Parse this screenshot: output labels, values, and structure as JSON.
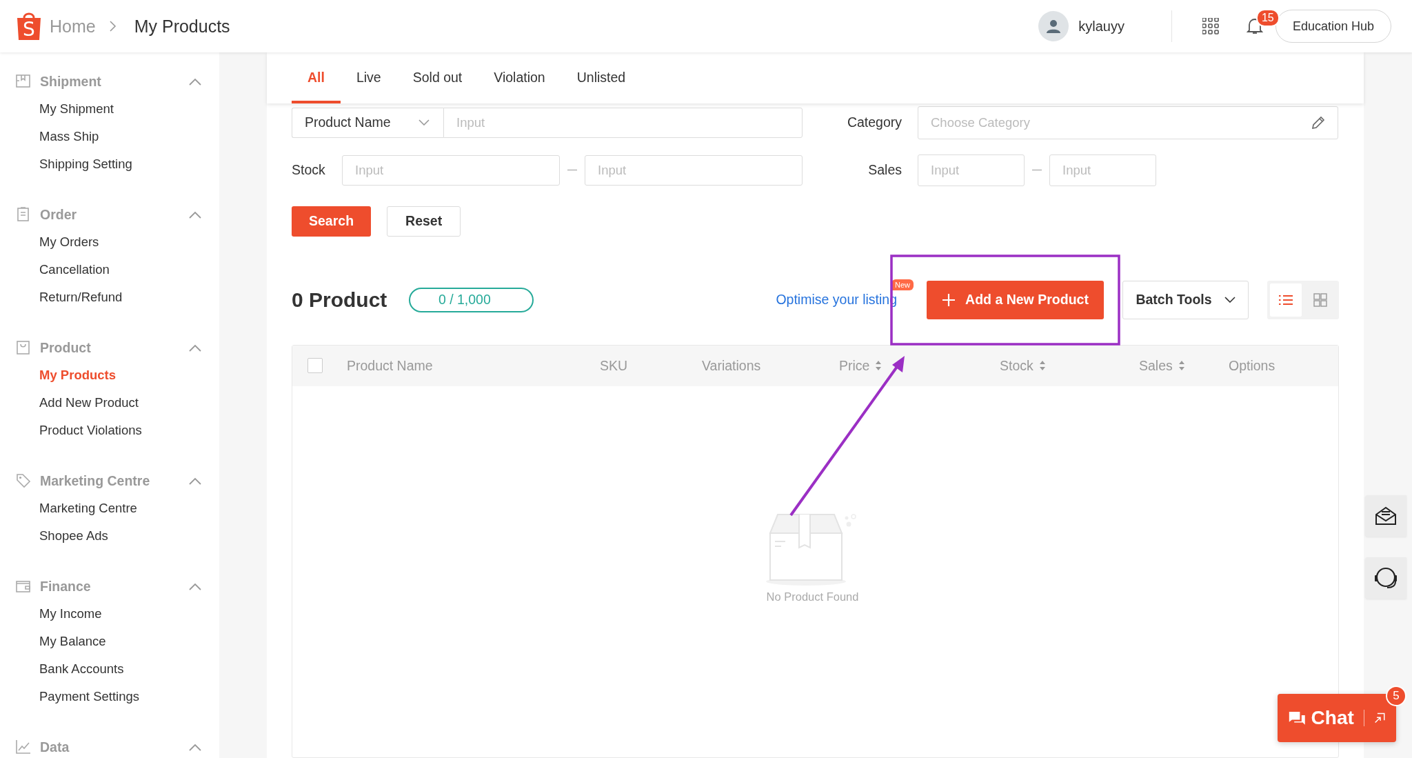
{
  "header": {
    "logo_letter": "S",
    "breadcrumb": [
      {
        "label": "Home"
      },
      {
        "label": "My Products"
      }
    ],
    "user": {
      "name": "kylauyy"
    },
    "notifications": {
      "count": "15"
    },
    "education_hub": "Education Hub"
  },
  "sidebar": {
    "sections": [
      {
        "title": "Shipment",
        "expanded": true,
        "items": [
          {
            "label": "My Shipment",
            "selected": false
          },
          {
            "label": "Mass Ship",
            "selected": false
          },
          {
            "label": "Shipping Setting",
            "selected": false
          }
        ]
      },
      {
        "title": "Order",
        "expanded": true,
        "items": [
          {
            "label": "My Orders",
            "selected": false
          },
          {
            "label": "Cancellation",
            "selected": false
          },
          {
            "label": "Return/Refund",
            "selected": false
          }
        ]
      },
      {
        "title": "Product",
        "expanded": true,
        "items": [
          {
            "label": "My Products",
            "selected": true
          },
          {
            "label": "Add New Product",
            "selected": false
          },
          {
            "label": "Product Violations",
            "selected": false
          }
        ]
      },
      {
        "title": "Marketing Centre",
        "expanded": true,
        "items": [
          {
            "label": "Marketing Centre",
            "selected": false
          },
          {
            "label": "Shopee Ads",
            "selected": false
          }
        ]
      },
      {
        "title": "Finance",
        "expanded": true,
        "items": [
          {
            "label": "My Income",
            "selected": false
          },
          {
            "label": "My Balance",
            "selected": false
          },
          {
            "label": "Bank Accounts",
            "selected": false
          },
          {
            "label": "Payment Settings",
            "selected": false
          }
        ]
      },
      {
        "title": "Data",
        "expanded": true
      }
    ]
  },
  "tabs": [
    {
      "label": "All",
      "selected": true
    },
    {
      "label": "Live",
      "selected": false
    },
    {
      "label": "Sold out",
      "selected": false
    },
    {
      "label": "Violation",
      "selected": false
    },
    {
      "label": "Unlisted",
      "selected": false
    }
  ],
  "filters": {
    "search_by": "Product Name",
    "search_placeholder": "Input",
    "category": {
      "label": "Category",
      "placeholder": "Choose Category"
    },
    "stock": {
      "label": "Stock",
      "min_placeholder": "Input",
      "max_placeholder": "Input"
    },
    "sales": {
      "label": "Sales",
      "min_placeholder": "Input",
      "max_placeholder": "Input"
    },
    "search_button": "Search",
    "reset_button": "Reset"
  },
  "products": {
    "count": "0 Product",
    "quota": "0 / 1,000",
    "optimise_link": "Optimise your listing",
    "new_badge": "New",
    "add_button": "Add a New Product",
    "batch_tools": "Batch Tools",
    "view_modes": [
      {
        "kind": "list",
        "selected": true
      },
      {
        "kind": "grid",
        "selected": false
      }
    ]
  },
  "table": {
    "select_all": {
      "checked": false
    },
    "columns": [
      {
        "label": "Product Name",
        "sortable": false
      },
      {
        "label": "SKU",
        "sortable": false
      },
      {
        "label": "Variations",
        "sortable": false
      },
      {
        "label": "Price",
        "sortable": true
      },
      {
        "label": "Stock",
        "sortable": true
      },
      {
        "label": "Sales",
        "sortable": true
      },
      {
        "label": "Options",
        "sortable": false
      }
    ],
    "empty_message": "No Product Found"
  },
  "chat": {
    "label": "Chat",
    "badge": "5"
  }
}
